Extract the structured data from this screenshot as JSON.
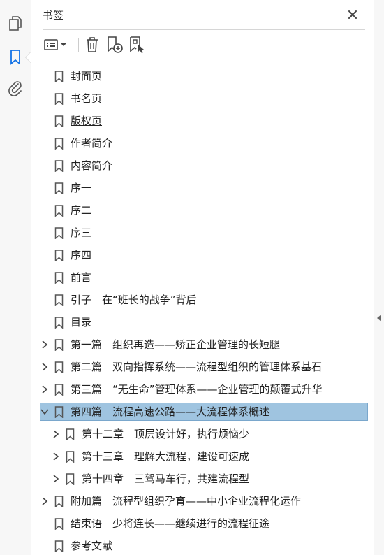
{
  "panel": {
    "title": "书签"
  },
  "rail": {
    "icons": [
      "pages-icon",
      "bookmark-icon",
      "attachment-icon"
    ]
  },
  "toolbar": {
    "icons": [
      "options-menu-icon",
      "delete-icon",
      "new-bookmark-icon",
      "new-bookmark-from-structure-icon"
    ]
  },
  "bookmarks": [
    {
      "label": "封面页",
      "level": 0,
      "caret": "none"
    },
    {
      "label": "书名页",
      "level": 0,
      "caret": "none"
    },
    {
      "label": "版权页",
      "level": 0,
      "caret": "none",
      "underline": true
    },
    {
      "label": "作者简介",
      "level": 0,
      "caret": "none"
    },
    {
      "label": "内容简介",
      "level": 0,
      "caret": "none"
    },
    {
      "label": "序一",
      "level": 0,
      "caret": "none"
    },
    {
      "label": "序二",
      "level": 0,
      "caret": "none"
    },
    {
      "label": "序三",
      "level": 0,
      "caret": "none"
    },
    {
      "label": "序四",
      "level": 0,
      "caret": "none"
    },
    {
      "label": "前言",
      "level": 0,
      "caret": "none"
    },
    {
      "label": "引子　在“班长的战争”背后",
      "level": 0,
      "caret": "none"
    },
    {
      "label": "目录",
      "level": 0,
      "caret": "none"
    },
    {
      "label": "第一篇　组织再造——矫正企业管理的长短腿",
      "level": 0,
      "caret": "collapsed"
    },
    {
      "label": "第二篇　双向指挥系统——流程型组织的管理体系基石",
      "level": 0,
      "caret": "collapsed"
    },
    {
      "label": "第三篇　“无生命”管理体系——企业管理的颠覆式升华",
      "level": 0,
      "caret": "collapsed"
    },
    {
      "label": "第四篇　流程高速公路——大流程体系概述",
      "level": 0,
      "caret": "expanded",
      "selected": true
    },
    {
      "label": "第十二章　顶层设计好，执行烦恼少",
      "level": 1,
      "caret": "collapsed"
    },
    {
      "label": "第十三章　理解大流程，建设可速成",
      "level": 1,
      "caret": "collapsed"
    },
    {
      "label": "第十四章　三驾马车行，共建流程型",
      "level": 1,
      "caret": "collapsed"
    },
    {
      "label": "附加篇　流程型组织孕育——中小企业流程化运作",
      "level": 0,
      "caret": "collapsed"
    },
    {
      "label": "结束语　少将连长——继续进行的流程征途",
      "level": 0,
      "caret": "none"
    },
    {
      "label": "参考文献",
      "level": 0,
      "caret": "none"
    }
  ]
}
